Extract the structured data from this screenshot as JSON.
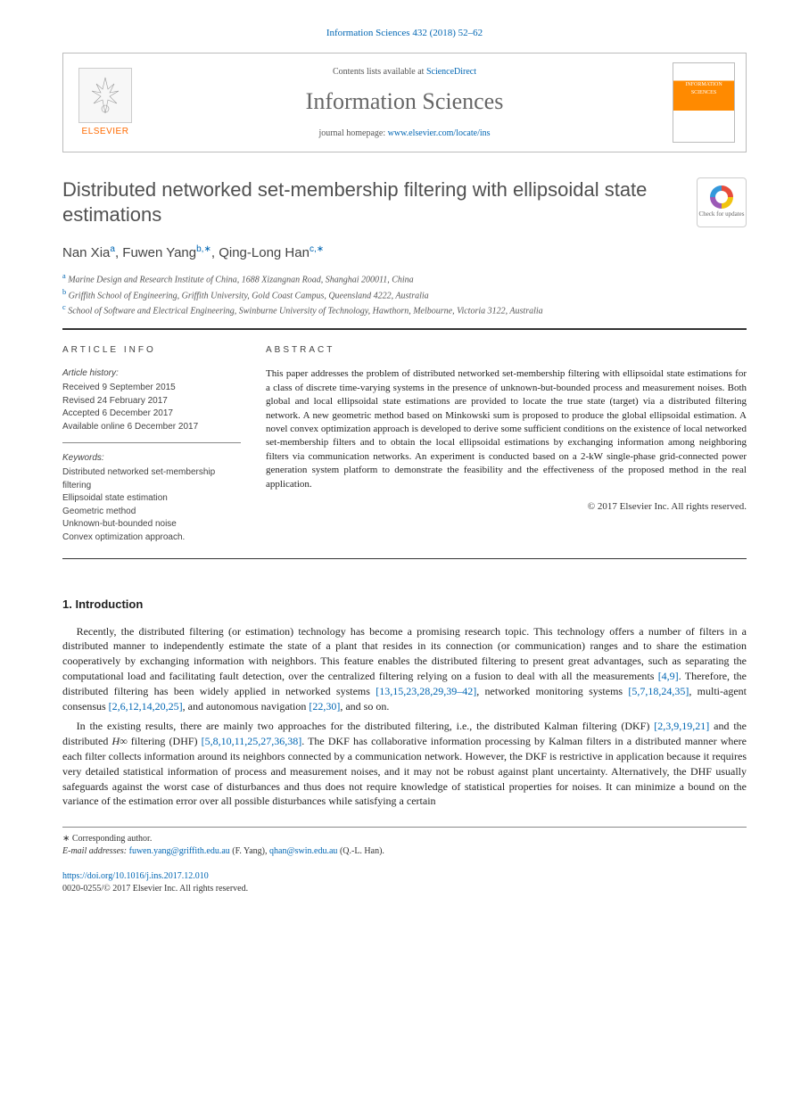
{
  "citation": "Information Sciences 432 (2018) 52–62",
  "header": {
    "contents_prefix": "Contents lists available at ",
    "contents_link": "ScienceDirect",
    "journal_name": "Information Sciences",
    "homepage_prefix": "journal homepage: ",
    "homepage_url": "www.elsevier.com/locate/ins",
    "publisher": "ELSEVIER",
    "cover_title": "INFORMATION SCIENCES"
  },
  "paper": {
    "title": "Distributed networked set-membership filtering with ellipsoidal state estimations",
    "crossmark_label": "Check for updates"
  },
  "authors": {
    "a1_name": "Nan Xia",
    "a1_aff": "a",
    "a2_name": "Fuwen Yang",
    "a2_aff": "b,",
    "a2_corr": "∗",
    "a3_name": "Qing-Long Han",
    "a3_aff": "c,",
    "a3_corr": "∗"
  },
  "affiliations": {
    "a_sup": "a",
    "a_text": " Marine Design and Research Institute of China, 1688 Xizangnan Road, Shanghai 200011, China",
    "b_sup": "b",
    "b_text": " Griffith School of Engineering, Griffith University, Gold Coast Campus, Queensland 4222, Australia",
    "c_sup": "c",
    "c_text": " School of Software and Electrical Engineering, Swinburne University of Technology, Hawthorn, Melbourne, Victoria 3122, Australia"
  },
  "article_info": {
    "heading": "ARTICLE INFO",
    "history_label": "Article history:",
    "received": "Received 9 September 2015",
    "revised": "Revised 24 February 2017",
    "accepted": "Accepted 6 December 2017",
    "online": "Available online 6 December 2017",
    "keywords_label": "Keywords:",
    "kw1": "Distributed networked set-membership filtering",
    "kw2": "Ellipsoidal state estimation",
    "kw3": "Geometric method",
    "kw4": "Unknown-but-bounded noise",
    "kw5": "Convex optimization approach."
  },
  "abstract": {
    "heading": "ABSTRACT",
    "text": "This paper addresses the problem of distributed networked set-membership filtering with ellipsoidal state estimations for a class of discrete time-varying systems in the presence of unknown-but-bounded process and measurement noises. Both global and local ellipsoidal state estimations are provided to locate the true state (target) via a distributed filtering network. A new geometric method based on Minkowski sum is proposed to produce the global ellipsoidal estimation. A novel convex optimization approach is developed to derive some sufficient conditions on the existence of local networked set-membership filters and to obtain the local ellipsoidal estimations by exchanging information among neighboring filters via communication networks. An experiment is conducted based on a 2-kW single-phase grid-connected power generation system platform to demonstrate the feasibility and the effectiveness of the proposed method in the real application.",
    "copyright": "© 2017 Elsevier Inc. All rights reserved."
  },
  "sections": {
    "intro_heading": "1. Introduction",
    "intro_p1_a": "Recently, the distributed filtering (or estimation) technology has become a promising research topic. This technology offers a number of filters in a distributed manner to independently estimate the state of a plant that resides in its connection (or communication) ranges and to share the estimation cooperatively by exchanging information with neighbors. This feature enables the distributed filtering to present great advantages, such as separating the computational load and facilitating fault detection, over the centralized filtering relying on a fusion to deal with all the measurements ",
    "intro_p1_ref1": "[4,9]",
    "intro_p1_b": ". Therefore, the distributed filtering has been widely applied in networked systems ",
    "intro_p1_ref2": "[13,15,23,28,29,39–42]",
    "intro_p1_c": ", networked monitoring systems ",
    "intro_p1_ref3": "[5,7,18,24,35]",
    "intro_p1_d": ", multi-agent consensus ",
    "intro_p1_ref4": "[2,6,12,14,20,25]",
    "intro_p1_e": ", and autonomous navigation ",
    "intro_p1_ref5": "[22,30]",
    "intro_p1_f": ", and so on.",
    "intro_p2_a": "In the existing results, there are mainly two approaches for the distributed filtering, i.e., the distributed Kalman filtering (DKF) ",
    "intro_p2_ref1": "[2,3,9,19,21]",
    "intro_p2_b": " and the distributed ",
    "intro_p2_hinf": "H∞",
    "intro_p2_c": " filtering (DHF) ",
    "intro_p2_ref2": "[5,8,10,11,25,27,36,38]",
    "intro_p2_d": ". The DKF has collaborative information processing by Kalman filters in a distributed manner where each filter collects information around its neighbors connected by a communication network. However, the DKF is restrictive in application because it requires very detailed statistical information of process and measurement noises, and it may not be robust against plant uncertainty. Alternatively, the DHF usually safeguards against the worst case of disturbances and thus does not require knowledge of statistical properties for noises. It can minimize a bound on the variance of the estimation error over all possible disturbances while satisfying a certain"
  },
  "footnotes": {
    "corr_label": "∗ Corresponding author.",
    "email_label": "E-mail addresses: ",
    "email1": "fuwen.yang@griffith.edu.au",
    "email1_name": " (F. Yang), ",
    "email2": "qhan@swin.edu.au",
    "email2_name": " (Q.-L. Han)."
  },
  "doi": {
    "url": "https://doi.org/10.1016/j.ins.2017.12.010",
    "issn_line": "0020-0255/© 2017 Elsevier Inc. All rights reserved."
  }
}
